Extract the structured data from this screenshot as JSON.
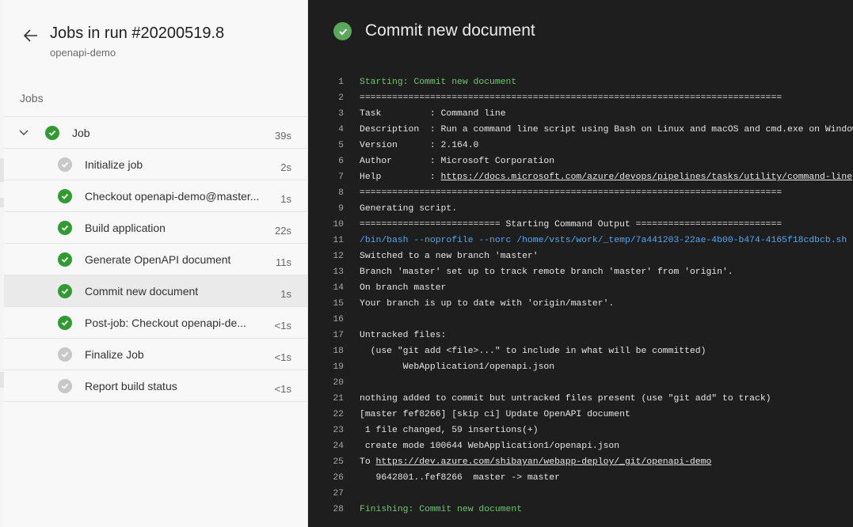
{
  "colors": {
    "success": "#339933",
    "pending": "#c8c8c8",
    "log_background": "#1e1e1e",
    "log_green": "#6ec86e",
    "log_blue": "#58a6f0"
  },
  "header": {
    "back_icon": "arrow-left-icon",
    "title": "Jobs in run #20200519.8",
    "subtitle": "openapi-demo"
  },
  "jobs_section": {
    "label": "Jobs",
    "job": {
      "name": "Job",
      "duration": "39s",
      "status": "succeeded",
      "expand_icon": "chevron-down-icon"
    },
    "steps": [
      {
        "name": "Initialize job",
        "duration": "2s",
        "status": "pending"
      },
      {
        "name": "Checkout openapi-demo@master...",
        "duration": "1s",
        "status": "succeeded"
      },
      {
        "name": "Build application",
        "duration": "22s",
        "status": "succeeded"
      },
      {
        "name": "Generate OpenAPI document",
        "duration": "11s",
        "status": "succeeded"
      },
      {
        "name": "Commit new document",
        "duration": "1s",
        "status": "succeeded",
        "selected": true
      },
      {
        "name": "Post-job: Checkout openapi-de...",
        "duration": "<1s",
        "status": "succeeded"
      },
      {
        "name": "Finalize Job",
        "duration": "<1s",
        "status": "pending"
      },
      {
        "name": "Report build status",
        "duration": "<1s",
        "status": "pending"
      }
    ]
  },
  "log_panel": {
    "title": "Commit new document",
    "status_icon": "check-circle-icon",
    "lines": [
      {
        "n": "1",
        "text": "Starting: Commit new document",
        "style": "green"
      },
      {
        "n": "2",
        "text": "=============================================================================="
      },
      {
        "n": "3",
        "text": "Task         : Command line"
      },
      {
        "n": "4",
        "text": "Description  : Run a command line script using Bash on Linux and macOS and cmd.exe on Windows"
      },
      {
        "n": "5",
        "text": "Version      : 2.164.0"
      },
      {
        "n": "6",
        "text": "Author       : Microsoft Corporation"
      },
      {
        "n": "7",
        "prefix": "Help         : ",
        "link": "https://docs.microsoft.com/azure/devops/pipelines/tasks/utility/command-line"
      },
      {
        "n": "8",
        "text": "=============================================================================="
      },
      {
        "n": "9",
        "text": "Generating script."
      },
      {
        "n": "10",
        "text": "========================== Starting Command Output ==========================="
      },
      {
        "n": "11",
        "text": "/bin/bash --noprofile --norc /home/vsts/work/_temp/7a441203-22ae-4b00-b474-4165f18cdbcb.sh",
        "style": "blue"
      },
      {
        "n": "12",
        "text": "Switched to a new branch 'master'"
      },
      {
        "n": "13",
        "text": "Branch 'master' set up to track remote branch 'master' from 'origin'."
      },
      {
        "n": "14",
        "text": "On branch master"
      },
      {
        "n": "15",
        "text": "Your branch is up to date with 'origin/master'."
      },
      {
        "n": "16",
        "text": ""
      },
      {
        "n": "17",
        "text": "Untracked files:"
      },
      {
        "n": "18",
        "text": "  (use \"git add <file>...\" to include in what will be committed)"
      },
      {
        "n": "19",
        "text": "        WebApplication1/openapi.json"
      },
      {
        "n": "20",
        "text": ""
      },
      {
        "n": "21",
        "text": "nothing added to commit but untracked files present (use \"git add\" to track)"
      },
      {
        "n": "22",
        "text": "[master fef8266] [skip ci] Update OpenAPI document"
      },
      {
        "n": "23",
        "text": " 1 file changed, 59 insertions(+)"
      },
      {
        "n": "24",
        "text": " create mode 100644 WebApplication1/openapi.json"
      },
      {
        "n": "25",
        "prefix": "To ",
        "link": "https://dev.azure.com/shibayan/webapp-deploy/_git/openapi-demo"
      },
      {
        "n": "26",
        "text": "   9642801..fef8266  master -> master"
      },
      {
        "n": "27",
        "text": ""
      },
      {
        "n": "28",
        "text": "Finishing: Commit new document",
        "style": "green"
      }
    ]
  }
}
